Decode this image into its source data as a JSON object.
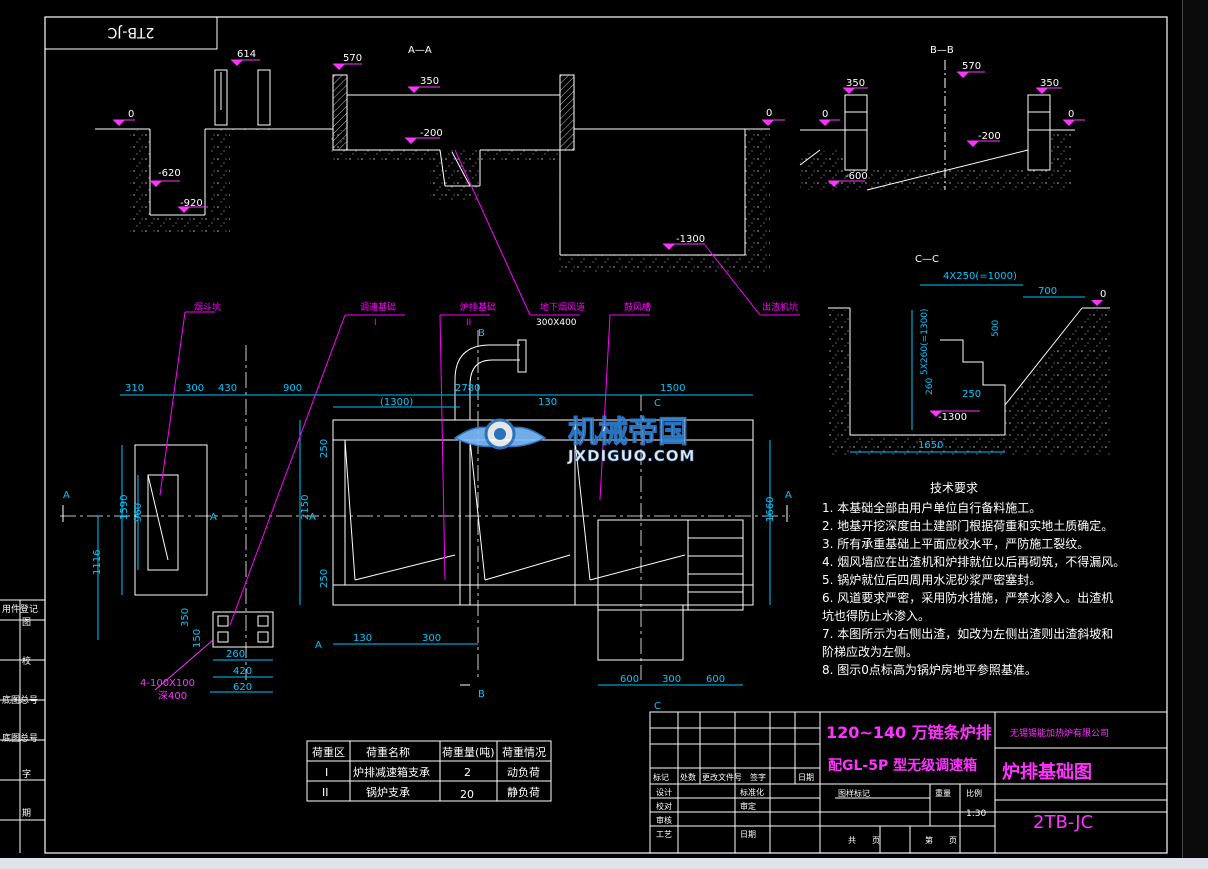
{
  "colors": {
    "background": "#000000",
    "frame": "#ffffff",
    "dimension": "#00c8ff",
    "leader": "#ff00ff",
    "title_magenta": "#ff33ff",
    "soil": "#9a9a9a",
    "watermark_blue": "#2f7fd0"
  },
  "frame": {
    "mirrored_code": "2TB-JC",
    "left_strip": [
      "用件登记",
      "图",
      "校",
      "底图总号",
      "底图总号",
      "字",
      "期"
    ]
  },
  "section_aa": {
    "title": "A—A",
    "elev": [
      "614",
      "570",
      "350",
      "0",
      "-200",
      "-620",
      "-920",
      "-1300"
    ]
  },
  "section_bb": {
    "title": "B—B",
    "elev": [
      "570",
      "350",
      "350",
      "0",
      "0",
      "-200",
      "-600"
    ]
  },
  "section_cc": {
    "title": "C—C",
    "dims": [
      "4X250(=1000)",
      "700",
      "0",
      "500",
      "5X260(=1300)",
      "260",
      "250",
      "-1300",
      "1650"
    ]
  },
  "plan": {
    "callouts": [
      "烟斗坑",
      "调速基础",
      "I",
      "炉排基础",
      "II",
      "地下烟风道",
      "300X400",
      "鼓风槽",
      "出渣机坑"
    ],
    "top_dims": [
      "310",
      "300",
      "430",
      "900",
      "2780",
      "1500",
      "(1300)",
      "130"
    ],
    "left_dims": [
      "1590",
      "960",
      "1116",
      "350",
      "150"
    ],
    "mid_dims": [
      "250",
      "2150",
      "250"
    ],
    "right_dims": [
      "1660"
    ],
    "bottom_dims": [
      "260",
      "420",
      "620",
      "130",
      "300",
      "600",
      "300",
      "600"
    ],
    "section_marks": [
      "A",
      "A",
      "A",
      "A",
      "A",
      "B",
      "B",
      "C",
      "C"
    ],
    "bolt_note_1": "4-100X100",
    "bolt_note_2": "深400"
  },
  "tech": {
    "title": "技术要求",
    "items": [
      "1. 本基础全部由用户单位自行备料施工。",
      "2. 地基开挖深度由土建部门根据荷重和实地土质确定。",
      "3. 所有承重基础上平面应校水平，严防施工裂纹。",
      "4. 烟风墙应在出渣机和炉排就位以后再砌筑，不得漏风。",
      "5. 锅炉就位后四周用水泥砂浆严密塞封。",
      "6. 风道要求严密，采用防水措施，严禁水渗入。出渣机",
      "    坑也得防止水渗入。",
      "7. 本图所示为右侧出渣，如改为左侧出渣则出渣斜坡和",
      "    阶梯应改为左侧。",
      "8. 图示0点标高为锅炉房地平参照基准。"
    ]
  },
  "load_table": {
    "headers": [
      "荷重区",
      "荷重名称",
      "荷重量(吨)",
      "荷重情况"
    ],
    "rows": [
      [
        "I",
        "炉排减速箱支承",
        "2",
        "动负荷"
      ],
      [
        "II",
        "锅炉支承",
        "20",
        "静负荷"
      ]
    ]
  },
  "title_block": {
    "project_line1": "120~140 万链条炉排",
    "project_line2": "配GL-5P 型无级调速箱",
    "company": "无锡锡能加热炉有限公司",
    "drawing_name": "炉排基础图",
    "drawing_code": "2TB-JC",
    "scale_label": "比例",
    "scale": "1:30",
    "weight_label": "重量",
    "stage_label": "图样标记",
    "sheet_total": "共　　页",
    "sheet_no": "第　　页",
    "rev_headers": [
      "标记",
      "处数",
      "更改文件号",
      "签字",
      "日期"
    ],
    "roles": [
      "设计",
      "校对",
      "审核",
      "工艺"
    ],
    "roles_right": [
      "标准化",
      "审定",
      "",
      "日期"
    ]
  },
  "watermark": {
    "brand": "机械帝国",
    "site": "JXDIGUO.COM"
  }
}
